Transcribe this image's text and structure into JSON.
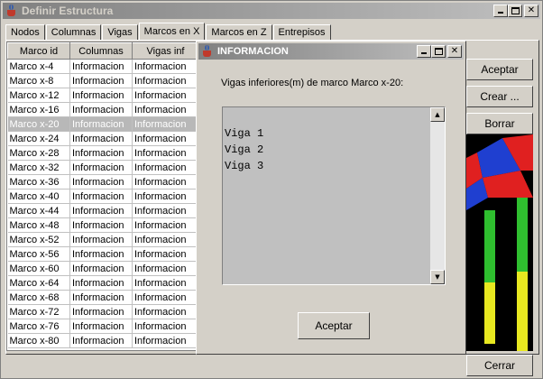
{
  "main_window": {
    "title": "Definir Estructura",
    "controls": {
      "minimize": "_",
      "maximize": "□",
      "close": "✕"
    }
  },
  "tabs": [
    "Nodos",
    "Columnas",
    "Vigas",
    "Marcos en X",
    "Marcos en Z",
    "Entrepisos"
  ],
  "active_tab": "Marcos en X",
  "table": {
    "headers": [
      "Marco id",
      "Columnas",
      "Vigas inf"
    ],
    "rows": [
      [
        "Marco x-4",
        "Informacion",
        "Informacion"
      ],
      [
        "Marco x-8",
        "Informacion",
        "Informacion"
      ],
      [
        "Marco x-12",
        "Informacion",
        "Informacion"
      ],
      [
        "Marco x-16",
        "Informacion",
        "Informacion"
      ],
      [
        "Marco x-20",
        "Informacion",
        "Informacion"
      ],
      [
        "Marco x-24",
        "Informacion",
        "Informacion"
      ],
      [
        "Marco x-28",
        "Informacion",
        "Informacion"
      ],
      [
        "Marco x-32",
        "Informacion",
        "Informacion"
      ],
      [
        "Marco x-36",
        "Informacion",
        "Informacion"
      ],
      [
        "Marco x-40",
        "Informacion",
        "Informacion"
      ],
      [
        "Marco x-44",
        "Informacion",
        "Informacion"
      ],
      [
        "Marco x-48",
        "Informacion",
        "Informacion"
      ],
      [
        "Marco x-52",
        "Informacion",
        "Informacion"
      ],
      [
        "Marco x-56",
        "Informacion",
        "Informacion"
      ],
      [
        "Marco x-60",
        "Informacion",
        "Informacion"
      ],
      [
        "Marco x-64",
        "Informacion",
        "Informacion"
      ],
      [
        "Marco x-68",
        "Informacion",
        "Informacion"
      ],
      [
        "Marco x-72",
        "Informacion",
        "Informacion"
      ],
      [
        "Marco x-76",
        "Informacion",
        "Informacion"
      ],
      [
        "Marco x-80",
        "Informacion",
        "Informacion"
      ]
    ],
    "selected_row": 4
  },
  "buttons": {
    "accept": "Aceptar",
    "create": "Crear ...",
    "delete": "Borrar",
    "close": "Cerrar"
  },
  "dialog": {
    "title": "INFORMACION",
    "message": "Vigas inferiores(m) de marco Marco x-20:",
    "lines": [
      "Viga 1",
      "Viga 2",
      "Viga 3"
    ],
    "accept_label": "Aceptar"
  },
  "colors": {
    "titlebar_inactive_start": "#808080",
    "titlebar_inactive_end": "#c0c0c0",
    "selection": "#b8b8b8",
    "render_red": "#e02020",
    "render_blue": "#1f3fd0",
    "render_green": "#2fbf2f",
    "render_yellow": "#e8e820"
  }
}
